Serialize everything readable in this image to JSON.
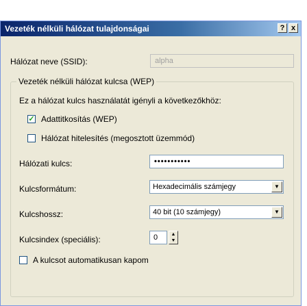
{
  "window": {
    "title": "Vezeték nélküli hálózat tulajdonságai",
    "help_label": "?",
    "close_label": "x"
  },
  "ssid": {
    "label": "Hálózat neve (SSID):",
    "value": "alpha"
  },
  "wep_group": {
    "title": "Vezeték nélküli hálózat kulcsa (WEP)",
    "description": "Ez a hálózat kulcs használatát igényli a következőkhöz:",
    "data_encryption": {
      "label": "Adattitkosítás (WEP)",
      "checked": true,
      "check_glyph": "✓"
    },
    "network_auth": {
      "label": "Hálózat hitelesítés (megosztott üzemmód)",
      "checked": false
    },
    "network_key": {
      "label": "Hálózati kulcs:",
      "value": "•••••••••••"
    },
    "key_format": {
      "label": "Kulcsformátum:",
      "value": "Hexadecimális számjegy"
    },
    "key_length": {
      "label": "Kulcshossz:",
      "value": "40 bit (10 számjegy)"
    },
    "key_index": {
      "label": "Kulcsindex (speciális):",
      "value": "0"
    },
    "auto_key": {
      "label": "A kulcsot automatikusan kapom",
      "checked": false
    }
  },
  "icons": {
    "dropdown": "▼",
    "spin_up": "▲",
    "spin_down": "▼"
  },
  "colors": {
    "titlebar_start": "#0a246a",
    "titlebar_end": "#a6caf0",
    "dialog_bg": "#ece9d8",
    "check_color": "#21a121"
  }
}
